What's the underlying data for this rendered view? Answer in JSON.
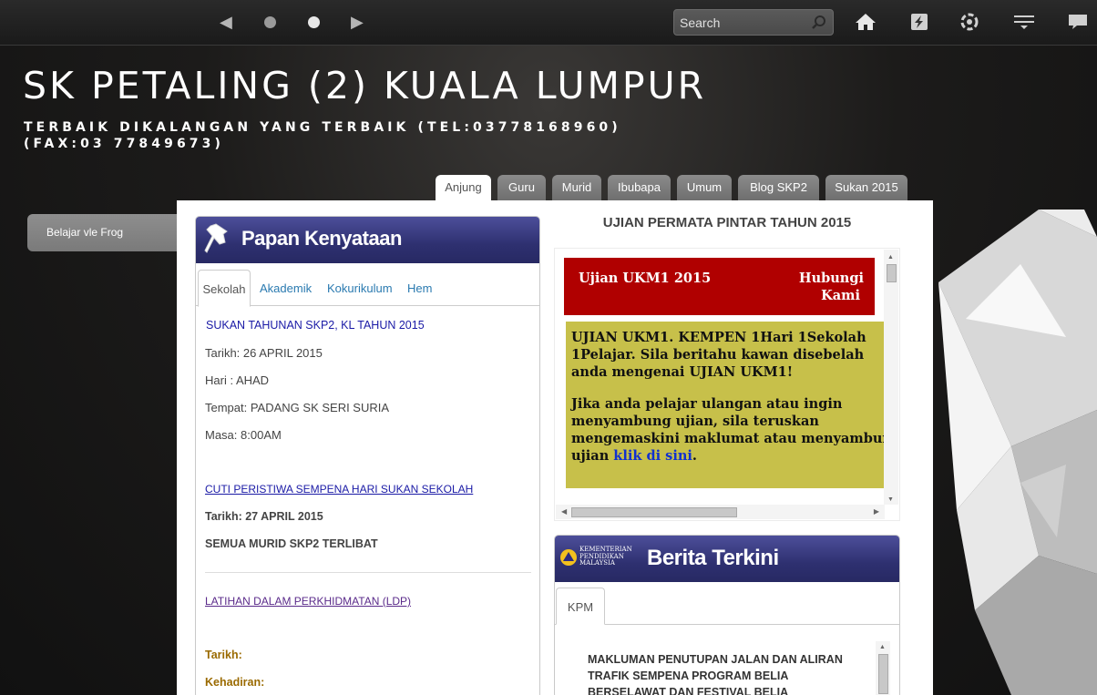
{
  "topbar": {
    "search_placeholder": "Search",
    "icons": [
      "arrow-left-icon",
      "dot-icon",
      "dot-icon",
      "arrow-right-icon",
      "search-icon",
      "home-icon",
      "flash-icon",
      "settings-icon",
      "menu-icon",
      "chat-icon"
    ]
  },
  "header": {
    "title": "SK PETALING (2) KUALA LUMPUR",
    "tagline": "TERBAIK DIKALANGAN YANG TERBAIK (TEL:03778168960)(FAX:03 77849673)"
  },
  "sidebar": {
    "button_label": "Belajar vle Frog"
  },
  "tabs": [
    "Anjung",
    "Guru",
    "Murid",
    "Ibubapa",
    "Umum",
    "Blog SKP2",
    "Sukan 2015"
  ],
  "notice": {
    "title": "Papan Kenyataan",
    "subtabs": [
      "Sekolah",
      "Akademik",
      "Kokurikulum",
      "Hem"
    ],
    "heading": "SUKAN TAHUNAN SKP2, KL TAHUN 2015",
    "tarikh": "Tarikh: 26 APRIL 2015",
    "hari": "Hari : AHAD",
    "tempat": "Tempat: PADANG SK SERI SURIA",
    "masa": "Masa: 8:00AM",
    "link1": "CUTI PERISTIWA SEMPENA HARI SUKAN SEKOLAH",
    "link1_tarikh": "Tarikh: 27 APRIL 2015",
    "link1_detail": "SEMUA MURID SKP2 TERLIBAT",
    "link2": "LATIHAN DALAM PERKHIDMATAN (LDP)",
    "tarikh_label": "Tarikh:",
    "kehadiran_label": "Kehadiran:"
  },
  "ujian": {
    "title": "UJIAN PERMATA PINTAR TAHUN 2015",
    "banner_left": "Ujian UKM1 2015",
    "banner_right_1": "Hubungi",
    "banner_right_2": "Kami",
    "p1_lines": [
      "UJIAN UKM1. KEMPEN 1Hari 1Sekolah",
      "1Pelajar. Sila beritahu kawan disebelah",
      "anda mengenai UJIAN UKM1!"
    ],
    "p2_lines": [
      "Jika anda pelajar ulangan atau ingin",
      "menyambung ujian, sila teruskan",
      "mengemaskini maklumat atau menyambung"
    ],
    "p2_last": "ujian ",
    "link": "klik di sini",
    "link_suffix": "."
  },
  "berita": {
    "logo_line1": "KEMENTERIAN",
    "logo_line2": "PENDIDIKAN",
    "logo_line3": "MALAYSIA",
    "title": "Berita Terkini",
    "tab": "KPM",
    "text": "MAKLUMAN PENUTUPAN JALAN DAN ALIRAN TRAFIK SEMPENA PROGRAM BELIA BERSELAWAT DAN FESTIVAL BELIA"
  },
  "colors": {
    "panel_blue": "#2e3070",
    "banner_red": "#b00000",
    "notice_yellow": "#c7c04a",
    "link_blue": "#1a1aa6",
    "link_purple": "#5a2a8a",
    "label_brown": "#9a6a00"
  }
}
